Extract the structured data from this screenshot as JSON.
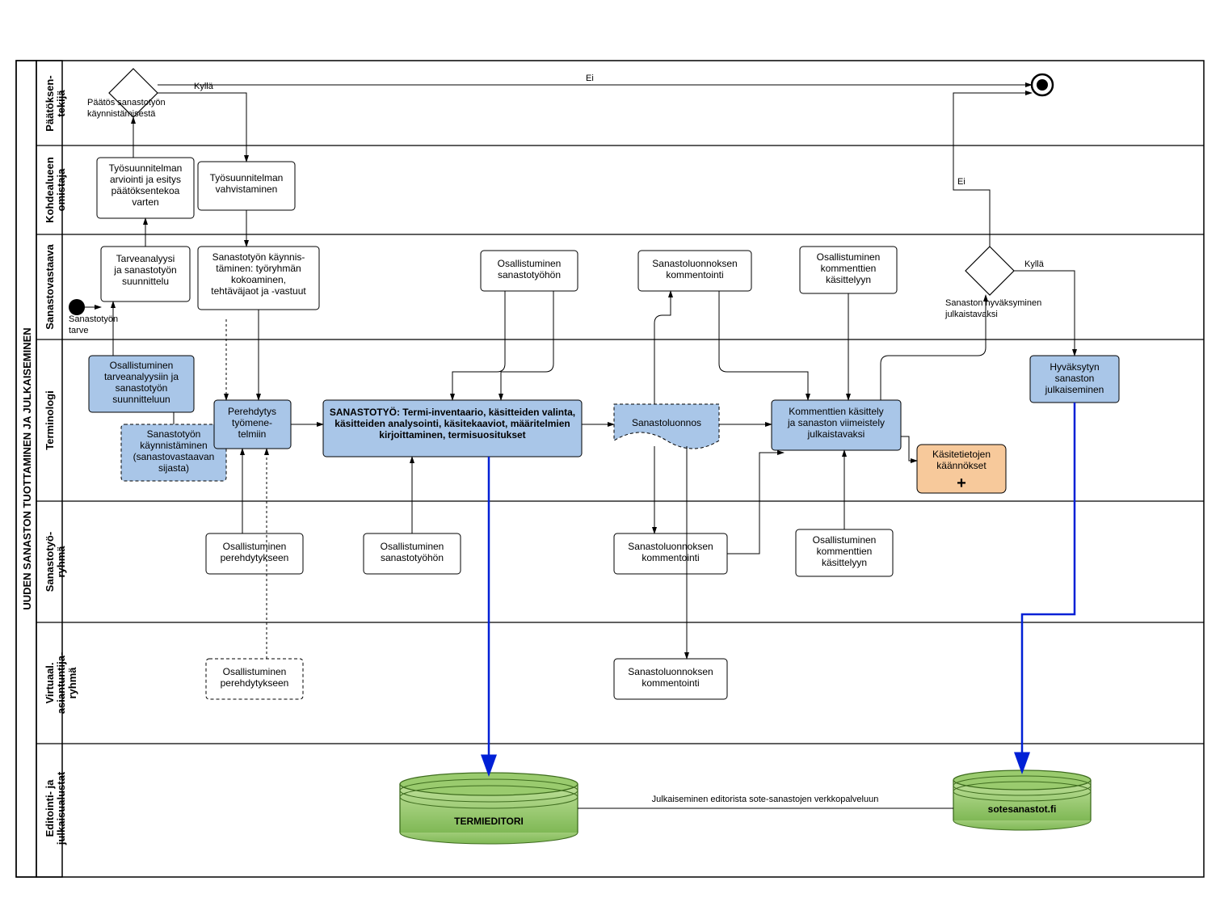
{
  "pool": {
    "title": "UUDEN SANASTON TUOTTAMINEN JA JULKAISEMINEN"
  },
  "lanes": {
    "l1": "Päätöksen-\ntekijä",
    "l2": "Kohdealueen\nomistaja",
    "l3": "Sanastovastaava",
    "l4": "Terminologi",
    "l5": "Sanastotyö-\nryhmä",
    "l6": "Virtuaal.\nasiantuntija-\nryhmä",
    "l7": "Editointi- ja\njulkaisualustat"
  },
  "events": {
    "start_label": "Sanastotyön\ntarve",
    "gateway1_label": "Päätös sanastotyön\nkäynnistämisestä",
    "gateway2_label": "Sanaston hyväksyminen\njulkaistavaksi",
    "yes": "Kyllä",
    "no": "Ei"
  },
  "tasks": {
    "t_tarve": "Tarveanalyysi\nja sanastotyön\nsuunnittelu",
    "t_osall_tarve": "Osallistuminen\ntarveanalyysiin ja\nsanastotyön\nsuunnitteluun",
    "t_arviointi": "Työsuunnitelman\narviointi ja esitys\npäätöksentekoa\nvarten",
    "t_vahvist": "Työsuunnitelman\nvahvistaminen",
    "t_kaynnis": "Sanastotyön käynnis-\ntäminen: työryhmän\nkokoaminen,\ntehtäväjaot ja -vastuut",
    "t_kaynnis_alt": "Sanastotyön\nkäynnistäminen\n(sanastovastaavan\nsijasta)",
    "t_perehdytys": "Perehdytys\ntyömene-\ntelmiin",
    "t_osall_pere1": "Osallistuminen\nperehdytykseen",
    "t_osall_pere2": "Osallistuminen\nperehdytykseen",
    "t_sanastotyo": "SANASTOTYÖ: Termi-inventaario, käsitteiden valinta,\nkäsitteiden analysointi, käsitekaaviot, määritelmien\nkirjoittaminen, termisuositukset",
    "t_osall_sanasto_sv": "Osallistuminen\nsanastotyöhön",
    "t_osall_sanasto_sr": "Osallistuminen\nsanastotyöhön",
    "t_luonnos": "Sanastoluonnos",
    "t_komm_sv": "Sanastoluonnoksen\nkommentointi",
    "t_komm_sr": "Sanastoluonnoksen\nkommentointi",
    "t_komm_vr": "Sanastoluonnoksen\nkommentointi",
    "t_komm_kasittely": "Kommenttien käsittely\nja sanaston viimeistely\njulkaistavaksi",
    "t_osall_komm_sv": "Osallistuminen\nkommenttien\nkäsittelyyn",
    "t_osall_komm_sr": "Osallistuminen\nkommenttien\nkäsittelyyn",
    "t_kaannokset": "Käsitetietojen\nkäännökset",
    "t_julkaisu": "Hyväksytyn\nsanaston\njulkaiseminen"
  },
  "datastores": {
    "ds1": "TERMIEDITORI",
    "ds2": "sotesanastot.fi",
    "ds_link": "Julkaiseminen editorista sote-sanastojen verkkopalveluun"
  },
  "chart_data": {
    "type": "diagram",
    "notation": "BPMN swimlane process",
    "pool": "UUDEN SANASTON TUOTTAMINEN JA JULKAISEMINEN",
    "lanes": [
      "Päätöksentekijä",
      "Kohdealueen omistaja",
      "Sanastovastaava",
      "Terminologi",
      "Sanastotyöryhmä",
      "Virtuaal. asiantuntijaryhmä",
      "Editointi- ja julkaisualustat"
    ],
    "start_event": {
      "lane": "Sanastovastaava",
      "label": "Sanastotyön tarve"
    },
    "end_event": {
      "lane": "Päätöksentekijä"
    },
    "gateways": [
      {
        "id": "g1",
        "lane": "Päätöksentekijä",
        "label": "Päätös sanastotyön käynnistämisestä",
        "outgoing": {
          "Kyllä": "Työsuunnitelman vahvistaminen",
          "Ei": "end"
        }
      },
      {
        "id": "g2",
        "lane": "Sanastovastaava",
        "label": "Sanaston hyväksyminen julkaistavaksi",
        "outgoing": {
          "Kyllä": "Hyväksytyn sanaston julkaiseminen",
          "Ei": "end (via Päätöksentekijä)"
        }
      }
    ],
    "tasks": [
      {
        "lane": "Sanastovastaava",
        "name": "Tarveanalyysi ja sanastotyön suunnittelu"
      },
      {
        "lane": "Terminologi",
        "name": "Osallistuminen tarveanalyysiin ja sanastotyön suunnitteluun",
        "style": "blue"
      },
      {
        "lane": "Kohdealueen omistaja",
        "name": "Työsuunnitelman arviointi ja esitys päätöksentekoa varten"
      },
      {
        "lane": "Kohdealueen omistaja",
        "name": "Työsuunnitelman vahvistaminen"
      },
      {
        "lane": "Sanastovastaava",
        "name": "Sanastotyön käynnistäminen: työryhmän kokoaminen, tehtäväjaot ja -vastuut"
      },
      {
        "lane": "Terminologi",
        "name": "Sanastotyön käynnistäminen (sanastovastaavan sijasta)",
        "style": "blue-dashed"
      },
      {
        "lane": "Terminologi",
        "name": "Perehdytys työmenetelmiin",
        "style": "blue"
      },
      {
        "lane": "Sanastotyöryhmä",
        "name": "Osallistuminen perehdytykseen"
      },
      {
        "lane": "Virtuaal. asiantuntijaryhmä",
        "name": "Osallistuminen perehdytykseen",
        "style": "dashed"
      },
      {
        "lane": "Terminologi",
        "name": "SANASTOTYÖ: Termi-inventaario, käsitteiden valinta, käsitteiden analysointi, käsitekaaviot, määritelmien kirjoittaminen, termisuositukset",
        "style": "blue"
      },
      {
        "lane": "Sanastovastaava",
        "name": "Osallistuminen sanastotyöhön"
      },
      {
        "lane": "Sanastotyöryhmä",
        "name": "Osallistuminen sanastotyöhön"
      },
      {
        "lane": "Terminologi",
        "name": "Sanastoluonnos",
        "style": "blue-document"
      },
      {
        "lane": "Sanastovastaava",
        "name": "Sanastoluonnoksen kommentointi"
      },
      {
        "lane": "Sanastotyöryhmä",
        "name": "Sanastoluonnoksen kommentointi"
      },
      {
        "lane": "Virtuaal. asiantuntijaryhmä",
        "name": "Sanastoluonnoksen kommentointi"
      },
      {
        "lane": "Terminologi",
        "name": "Kommenttien käsittely ja sanaston viimeistely julkaistavaksi",
        "style": "blue"
      },
      {
        "lane": "Sanastovastaava",
        "name": "Osallistuminen kommenttien käsittelyyn"
      },
      {
        "lane": "Sanastotyöryhmä",
        "name": "Osallistuminen kommenttien käsittelyyn"
      },
      {
        "lane": "Terminologi",
        "name": "Käsitetietojen käännökset",
        "style": "peach-subprocess"
      },
      {
        "lane": "Terminologi",
        "name": "Hyväksytyn sanaston julkaiseminen",
        "style": "blue"
      }
    ],
    "datastores": [
      {
        "lane": "Editointi- ja julkaisualustat",
        "name": "TERMIEDITORI"
      },
      {
        "lane": "Editointi- ja julkaisualustat",
        "name": "sotesanastot.fi"
      }
    ],
    "data_flows": [
      {
        "from": "SANASTOTYÖ",
        "to": "TERMIEDITORI"
      },
      {
        "from": "Hyväksytyn sanaston julkaiseminen",
        "to": "sotesanastot.fi"
      },
      {
        "from": "TERMIEDITORI",
        "to": "sotesanastot.fi",
        "label": "Julkaiseminen editorista sote-sanastojen verkkopalveluun"
      }
    ]
  }
}
